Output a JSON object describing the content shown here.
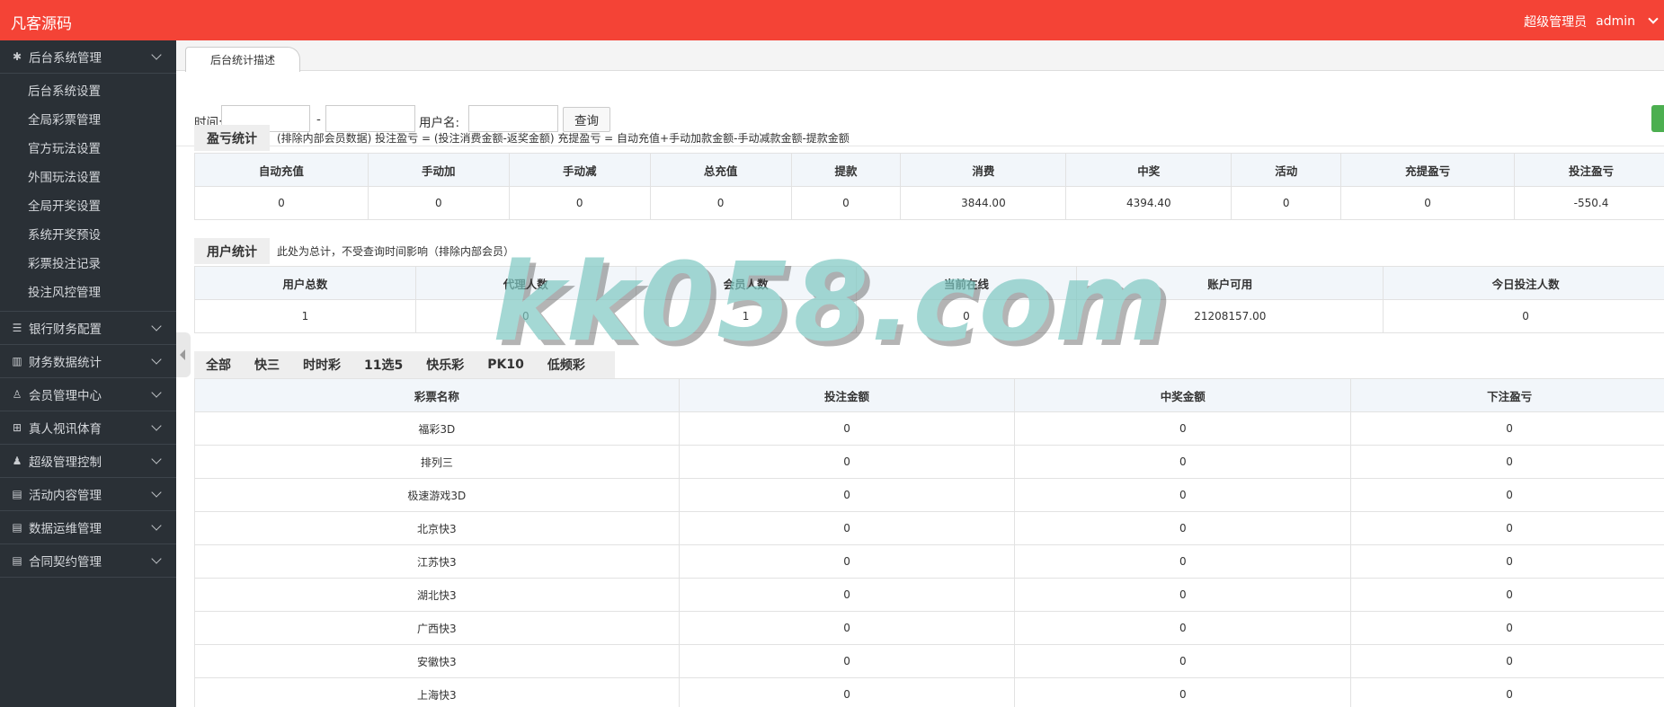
{
  "app": {
    "brand": "凡客源码",
    "role": "超级管理员",
    "user": "admin"
  },
  "sidebar": {
    "groups": [
      {
        "label": "后台系统管理",
        "icon": "gear-icon",
        "sub": [
          "后台系统设置",
          "全局彩票管理",
          "官方玩法设置",
          "外围玩法设置",
          "全局开奖设置",
          "系统开奖预设",
          "彩票投注记录",
          "投注风控管理"
        ]
      },
      {
        "label": "银行财务配置",
        "icon": "list-icon"
      },
      {
        "label": "财务数据统计",
        "icon": "bar-chart-icon"
      },
      {
        "label": "会员管理中心",
        "icon": "user-icon"
      },
      {
        "label": "真人视讯体育",
        "icon": "grid-icon"
      },
      {
        "label": "超级管理控制",
        "icon": "admin-user-icon"
      },
      {
        "label": "活动内容管理",
        "icon": "document-icon"
      },
      {
        "label": "数据运维管理",
        "icon": "document-icon"
      },
      {
        "label": "合同契约管理",
        "icon": "document-icon"
      }
    ]
  },
  "tab": {
    "label": "后台统计描述"
  },
  "search": {
    "time_label": "时间:",
    "dash": "-",
    "user_label": "用户名:",
    "query_button": "查询"
  },
  "profit": {
    "title": "盈亏统计",
    "note": "(排除内部会员数据)  投注盈亏 = (投注消费金额-返奖金额)     充提盈亏 = 自动充值+手动加款金额-手动减款金额-提款金额",
    "headers": [
      "自动充值",
      "手动加",
      "手动减",
      "总充值",
      "提款",
      "消费",
      "中奖",
      "活动",
      "充提盈亏",
      "投注盈亏"
    ],
    "values": [
      "0",
      "0",
      "0",
      "0",
      "0",
      "3844.00",
      "4394.40",
      "0",
      "0",
      "-550.4"
    ]
  },
  "users": {
    "title": "用户统计",
    "note": "此处为总计，不受查询时间影响（排除内部会员）",
    "headers": [
      "用户总数",
      "代理人数",
      "会员人数",
      "当前在线",
      "账户可用",
      "今日投注人数"
    ],
    "values": [
      "1",
      "0",
      "1",
      "0",
      "21208157.00",
      "0"
    ]
  },
  "lottery_tabs": [
    "全部",
    "快三",
    "时时彩",
    "11选5",
    "快乐彩",
    "PK10",
    "低频彩"
  ],
  "lottery_table": {
    "headers": [
      "彩票名称",
      "投注金额",
      "中奖金额",
      "下注盈亏"
    ],
    "rows": [
      [
        "福彩3D",
        "0",
        "0",
        "0"
      ],
      [
        "排列三",
        "0",
        "0",
        "0"
      ],
      [
        "极速游戏3D",
        "0",
        "0",
        "0"
      ],
      [
        "北京快3",
        "0",
        "0",
        "0"
      ],
      [
        "江苏快3",
        "0",
        "0",
        "0"
      ],
      [
        "湖北快3",
        "0",
        "0",
        "0"
      ],
      [
        "广西快3",
        "0",
        "0",
        "0"
      ],
      [
        "安徽快3",
        "0",
        "0",
        "0"
      ],
      [
        "上海快3",
        "0",
        "0",
        "0"
      ]
    ]
  },
  "watermark": "kk058.com",
  "colors": {
    "topbar": "#f44336",
    "sidebar": "#2a3036"
  }
}
